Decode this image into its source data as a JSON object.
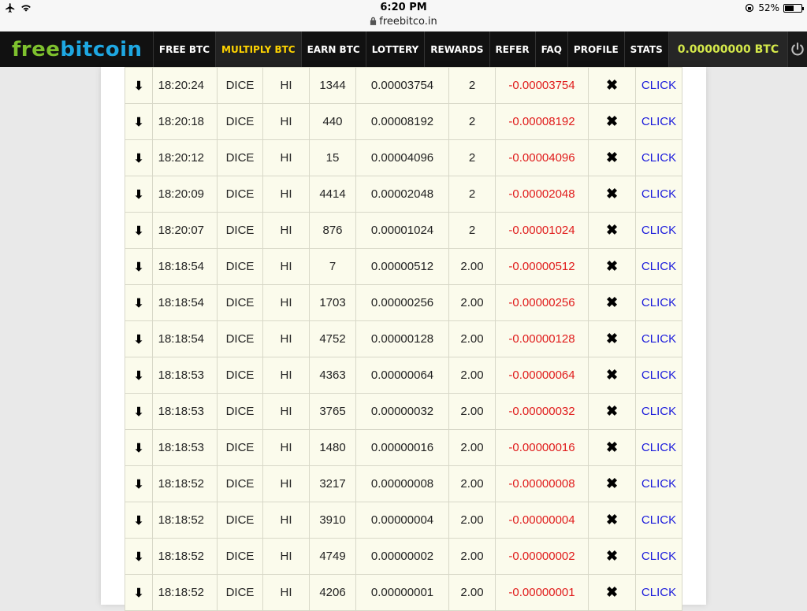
{
  "status_bar": {
    "time": "6:20 PM",
    "url": "freebitco.in",
    "battery": "52%"
  },
  "brand": {
    "part1": "free",
    "part2": "bitcoin"
  },
  "nav": {
    "items": [
      {
        "label": "FREE BTC",
        "active": false
      },
      {
        "label": "MULTIPLY BTC",
        "active": true
      },
      {
        "label": "EARN BTC",
        "active": false
      },
      {
        "label": "LOTTERY",
        "active": false
      },
      {
        "label": "REWARDS",
        "active": false
      },
      {
        "label": "REFER",
        "active": false
      },
      {
        "label": "FAQ",
        "active": false
      },
      {
        "label": "PROFILE",
        "active": false
      },
      {
        "label": "STATS",
        "active": false
      }
    ],
    "balance": "0.00000000 BTC"
  },
  "bets": [
    {
      "time": "18:20:24",
      "game": "DICE",
      "bet": "HI",
      "roll": "1344",
      "stake": "0.00003754",
      "payout": "2",
      "profit": "-0.00003754",
      "verify": "CLICK"
    },
    {
      "time": "18:20:18",
      "game": "DICE",
      "bet": "HI",
      "roll": "440",
      "stake": "0.00008192",
      "payout": "2",
      "profit": "-0.00008192",
      "verify": "CLICK"
    },
    {
      "time": "18:20:12",
      "game": "DICE",
      "bet": "HI",
      "roll": "15",
      "stake": "0.00004096",
      "payout": "2",
      "profit": "-0.00004096",
      "verify": "CLICK"
    },
    {
      "time": "18:20:09",
      "game": "DICE",
      "bet": "HI",
      "roll": "4414",
      "stake": "0.00002048",
      "payout": "2",
      "profit": "-0.00002048",
      "verify": "CLICK"
    },
    {
      "time": "18:20:07",
      "game": "DICE",
      "bet": "HI",
      "roll": "876",
      "stake": "0.00001024",
      "payout": "2",
      "profit": "-0.00001024",
      "verify": "CLICK"
    },
    {
      "time": "18:18:54",
      "game": "DICE",
      "bet": "HI",
      "roll": "7",
      "stake": "0.00000512",
      "payout": "2.00",
      "profit": "-0.00000512",
      "verify": "CLICK"
    },
    {
      "time": "18:18:54",
      "game": "DICE",
      "bet": "HI",
      "roll": "1703",
      "stake": "0.00000256",
      "payout": "2.00",
      "profit": "-0.00000256",
      "verify": "CLICK"
    },
    {
      "time": "18:18:54",
      "game": "DICE",
      "bet": "HI",
      "roll": "4752",
      "stake": "0.00000128",
      "payout": "2.00",
      "profit": "-0.00000128",
      "verify": "CLICK"
    },
    {
      "time": "18:18:53",
      "game": "DICE",
      "bet": "HI",
      "roll": "4363",
      "stake": "0.00000064",
      "payout": "2.00",
      "profit": "-0.00000064",
      "verify": "CLICK"
    },
    {
      "time": "18:18:53",
      "game": "DICE",
      "bet": "HI",
      "roll": "3765",
      "stake": "0.00000032",
      "payout": "2.00",
      "profit": "-0.00000032",
      "verify": "CLICK"
    },
    {
      "time": "18:18:53",
      "game": "DICE",
      "bet": "HI",
      "roll": "1480",
      "stake": "0.00000016",
      "payout": "2.00",
      "profit": "-0.00000016",
      "verify": "CLICK"
    },
    {
      "time": "18:18:52",
      "game": "DICE",
      "bet": "HI",
      "roll": "3217",
      "stake": "0.00000008",
      "payout": "2.00",
      "profit": "-0.00000008",
      "verify": "CLICK"
    },
    {
      "time": "18:18:52",
      "game": "DICE",
      "bet": "HI",
      "roll": "3910",
      "stake": "0.00000004",
      "payout": "2.00",
      "profit": "-0.00000004",
      "verify": "CLICK"
    },
    {
      "time": "18:18:52",
      "game": "DICE",
      "bet": "HI",
      "roll": "4749",
      "stake": "0.00000002",
      "payout": "2.00",
      "profit": "-0.00000002",
      "verify": "CLICK"
    },
    {
      "time": "18:18:52",
      "game": "DICE",
      "bet": "HI",
      "roll": "4206",
      "stake": "0.00000001",
      "payout": "2.00",
      "profit": "-0.00000001",
      "verify": "CLICK"
    }
  ],
  "colors": {
    "nav_bg": "#111111",
    "active_nav": "#ffd400",
    "balance": "#d4e84a",
    "logo_free": "#7ec12e",
    "logo_bitcoin": "#1ea7e2",
    "loss": "#e01b1b",
    "link": "#1a1adb",
    "row_bg": "#fbfbec"
  },
  "icons": {
    "row_expand": "arrow-down-icon",
    "row_result": "x-mark-icon",
    "logout": "power-icon"
  }
}
